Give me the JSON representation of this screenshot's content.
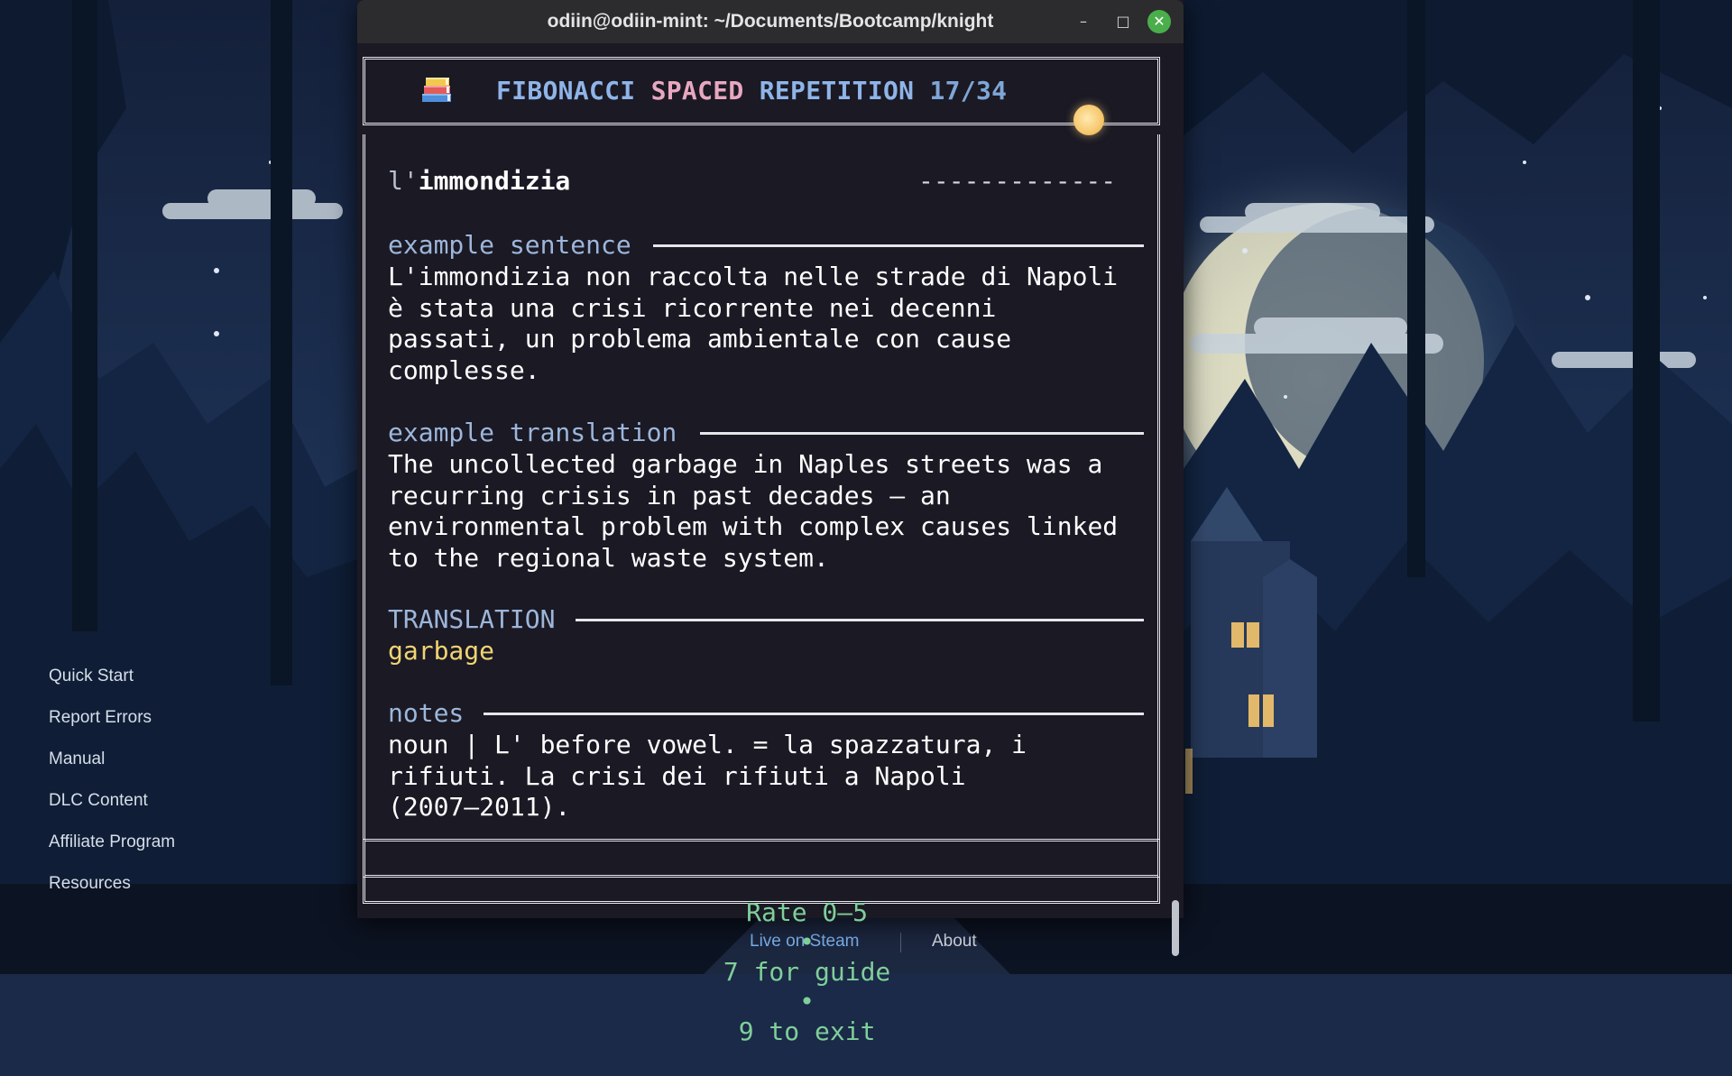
{
  "window": {
    "title": "odiin@odiin-mint: ~/Documents/Bootcamp/knight",
    "controls": {
      "minimize": "–",
      "maximize": "□",
      "close": "✕"
    }
  },
  "header": {
    "icon": "books-icon",
    "word1": "FIBONACCI",
    "word2": "SPACED",
    "word3": "REPETITION",
    "progress": "17/34"
  },
  "card": {
    "article": "l'",
    "term": "immondizia",
    "placeholder": "-------------",
    "example_sentence": {
      "label": "example sentence",
      "lines": [
        "L'immondizia non raccolta nelle strade di Napoli",
        "è stata una crisi ricorrente nei decenni",
        "passati, un problema ambientale con cause",
        "complesse."
      ]
    },
    "example_translation": {
      "label": "example translation",
      "lines": [
        "The uncollected garbage in Naples streets was a",
        "recurring crisis in past decades — an",
        "environmental problem with complex causes linked",
        "to the regional waste system."
      ]
    },
    "translation": {
      "label": "TRANSLATION",
      "value": "garbage"
    },
    "notes": {
      "label": "notes",
      "lines": [
        "noun | L' before vowel. = la spazzatura, i",
        "rifiuti. La crisi dei rifiuti a Napoli",
        "(2007–2011)."
      ]
    }
  },
  "footer": {
    "rate": "Rate 0–5",
    "guide": "7 for guide",
    "exit": "9 to exit",
    "bullet": "•"
  },
  "side_menu": [
    "Quick Start",
    "Report Errors",
    "Manual",
    "DLC Content",
    "Affiliate Program",
    "Resources"
  ],
  "bottom_links": {
    "live": "Live on Steam",
    "about": "About"
  },
  "colors": {
    "sky": "#1a2a48",
    "terminal_bg": "#1a1924",
    "label_blue": "#9db6da",
    "translation_yellow": "#f1d473",
    "footer_green": "#7fcf9a",
    "header_pink": "#e8a7c0",
    "close_green": "#4aae4a"
  }
}
